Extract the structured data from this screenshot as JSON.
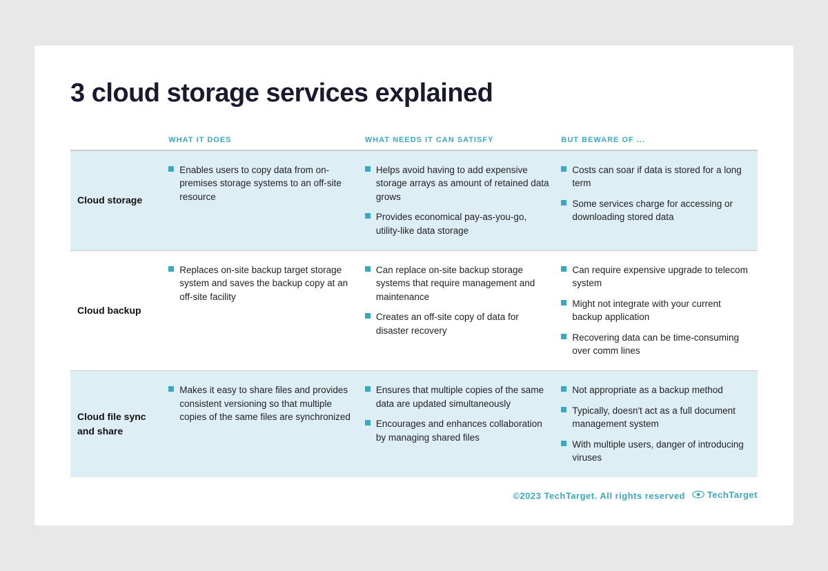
{
  "page": {
    "title": "3 cloud storage services explained",
    "background": "#e8e8e8"
  },
  "columns": {
    "col1": "",
    "col2": "What it does",
    "col3": "What needs it can satisfy",
    "col4": "But beware of ..."
  },
  "rows": [
    {
      "label": "Cloud storage",
      "does": [
        "Enables users to copy data from on-premises storage systems to an off-site resource"
      ],
      "needs": [
        "Helps avoid having to add expensive storage arrays as amount of retained data grows",
        "Provides economical pay-as-you-go, utility-like data storage"
      ],
      "beware": [
        "Costs can soar if data is stored for a long term",
        "Some services charge for accessing or downloading stored data"
      ]
    },
    {
      "label": "Cloud backup",
      "does": [
        "Replaces on-site backup target storage system and saves the backup copy at an off-site facility"
      ],
      "needs": [
        "Can replace on-site backup storage systems that require management and maintenance",
        "Creates an off-site copy of data for disaster recovery"
      ],
      "beware": [
        "Can require expensive upgrade to telecom system",
        "Might not integrate with your current backup application",
        "Recovering data can be time-consuming over comm lines"
      ]
    },
    {
      "label": "Cloud file sync and share",
      "does": [
        "Makes it easy to share files and provides consistent versioning so that multiple copies of the same files are synchronized"
      ],
      "needs": [
        "Ensures that multiple copies of the same data are updated simultaneously",
        "Encourages and enhances collaboration by managing shared files"
      ],
      "beware": [
        "Not appropriate as a backup method",
        "Typically, doesn't act as a full document management system",
        "With multiple users, danger of introducing viruses"
      ]
    }
  ],
  "footer": {
    "copyright": "©2023 TechTarget. All rights reserved",
    "brand": "TechTarget"
  }
}
